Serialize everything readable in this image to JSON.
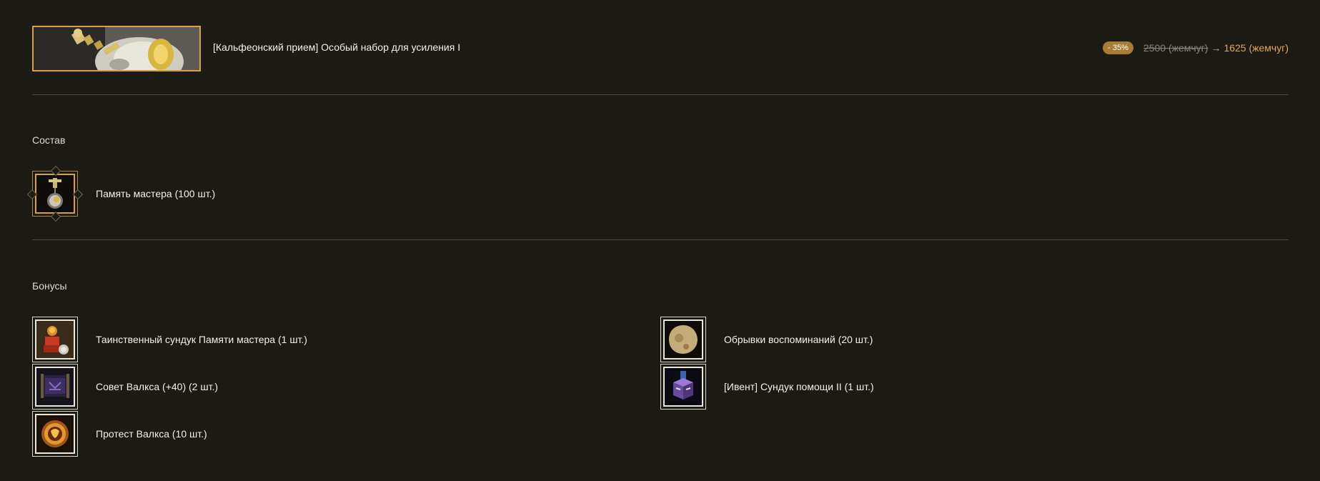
{
  "header": {
    "title": "[Кальфеонский прием] Особый набор для усиления I",
    "discount_badge": "- 35%",
    "old_price": "2500 (жемчуг)",
    "arrow": "→",
    "new_price": "1625 (жемчуг)",
    "banner_icon": "enhancement-bundle-banner"
  },
  "composition": {
    "label": "Состав",
    "items": [
      {
        "label": "Память мастера (100 шт.)",
        "icon": "master-memory-icon"
      }
    ]
  },
  "bonuses": {
    "label": "Бонусы",
    "left": [
      {
        "label": "Таинственный сундук Памяти мастера (1 шт.)",
        "icon": "mystery-chest-icon"
      },
      {
        "label": "Совет Валкса (+40) (2 шт.)",
        "icon": "valks-advice-icon"
      },
      {
        "label": "Протест Валкса (10 шт.)",
        "icon": "valks-protest-icon"
      }
    ],
    "right": [
      {
        "label": "Обрывки воспоминаний (20 шт.)",
        "icon": "memory-fragment-icon"
      },
      {
        "label": "[Ивент] Сундук помощи II (1 шт.)",
        "icon": "help-chest-icon"
      }
    ]
  },
  "colors": {
    "background": "#1b1a14",
    "accent_gold": "#d9a04a",
    "new_price": "#e3a85b",
    "badge": "#a87c34"
  }
}
